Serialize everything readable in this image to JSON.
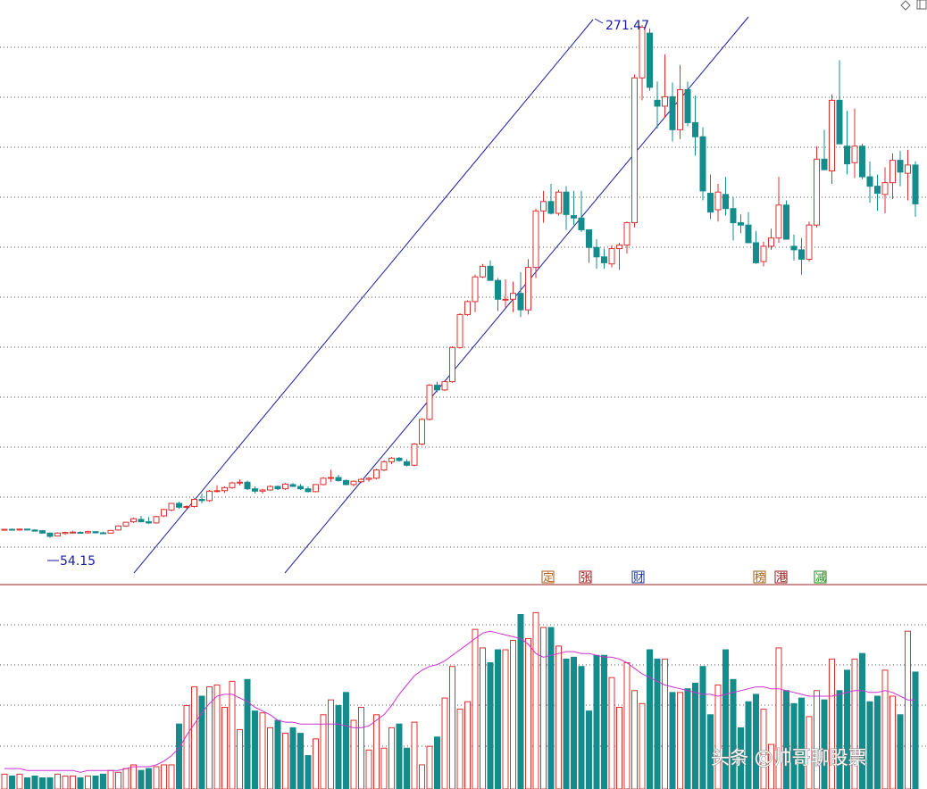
{
  "chart_data": [
    {
      "type": "candlestick",
      "panel": "price",
      "ylim": [
        40,
        275
      ],
      "grid": true,
      "colors": {
        "up": "#e03030",
        "down": "#148c8c",
        "channel": "#1a1aa6",
        "grid": "#555555"
      },
      "annotations": {
        "high": "271.47",
        "low": "54.15"
      },
      "x_count": 121,
      "candles": [
        [
          57.4,
          58.0,
          57.2,
          57.8
        ],
        [
          57.8,
          58.2,
          57.5,
          57.6
        ],
        [
          57.5,
          58.0,
          57.2,
          57.9
        ],
        [
          57.9,
          58.0,
          57.3,
          57.5
        ],
        [
          57.5,
          57.8,
          56.8,
          57.0
        ],
        [
          57.2,
          57.5,
          56.0,
          56.2
        ],
        [
          56.2,
          56.5,
          54.2,
          54.8
        ],
        [
          55.0,
          56.5,
          54.8,
          56.2
        ],
        [
          56.0,
          56.8,
          55.5,
          56.5
        ],
        [
          56.5,
          57.2,
          56.0,
          56.6
        ],
        [
          56.5,
          57.0,
          56.0,
          56.3
        ],
        [
          56.3,
          57.2,
          56.0,
          56.8
        ],
        [
          56.8,
          57.0,
          56.0,
          56.3
        ],
        [
          56.3,
          56.8,
          55.8,
          56.1
        ],
        [
          56.2,
          57.5,
          56.0,
          57.3
        ],
        [
          57.5,
          59.5,
          57.2,
          59.2
        ],
        [
          59.2,
          61.0,
          58.8,
          60.8
        ],
        [
          61.0,
          62.8,
          60.5,
          62.3
        ],
        [
          62.0,
          63.5,
          60.8,
          61.0
        ],
        [
          61.0,
          63.0,
          60.0,
          60.5
        ],
        [
          60.5,
          63.5,
          60.2,
          63.2
        ],
        [
          63.5,
          66.5,
          63.0,
          66.2
        ],
        [
          66.0,
          69.0,
          65.5,
          68.8
        ],
        [
          68.8,
          69.5,
          66.5,
          67.2
        ],
        [
          67.3,
          68.0,
          66.5,
          67.5
        ],
        [
          67.5,
          71.0,
          67.0,
          70.5
        ],
        [
          70.5,
          73.0,
          68.8,
          70.0
        ],
        [
          70.0,
          74.5,
          69.5,
          74.0
        ],
        [
          74.0,
          76.5,
          73.5,
          74.2
        ],
        [
          74.2,
          76.0,
          73.2,
          75.5
        ],
        [
          75.5,
          78.0,
          75.0,
          77.5
        ],
        [
          77.5,
          79.0,
          76.5,
          77.8
        ],
        [
          77.8,
          78.5,
          74.5,
          75.0
        ],
        [
          75.0,
          76.0,
          73.0,
          74.0
        ],
        [
          74.0,
          75.0,
          73.0,
          74.5
        ],
        [
          74.5,
          76.5,
          74.2,
          76.0
        ],
        [
          76.0,
          76.5,
          74.5,
          75.0
        ],
        [
          75.0,
          77.5,
          74.5,
          77.0
        ],
        [
          76.8,
          77.5,
          75.8,
          76.0
        ],
        [
          76.0,
          77.0,
          74.5,
          75.0
        ],
        [
          75.0,
          76.0,
          73.5,
          73.8
        ],
        [
          73.8,
          77.0,
          73.5,
          76.8
        ],
        [
          76.8,
          80.0,
          76.5,
          79.5
        ],
        [
          79.5,
          83.0,
          78.0,
          79.8
        ],
        [
          79.8,
          81.0,
          78.0,
          78.5
        ],
        [
          78.5,
          79.0,
          76.5,
          76.8
        ],
        [
          76.8,
          78.5,
          76.0,
          78.2
        ],
        [
          78.0,
          79.5,
          77.5,
          79.0
        ],
        [
          79.0,
          80.0,
          78.0,
          79.5
        ],
        [
          79.5,
          83.5,
          79.0,
          83.0
        ],
        [
          83.0,
          87.0,
          82.5,
          86.5
        ],
        [
          86.5,
          88.5,
          85.5,
          88.0
        ],
        [
          88.0,
          88.5,
          86.5,
          87.0
        ],
        [
          86.5,
          87.5,
          84.5,
          85.0
        ],
        [
          85.0,
          94.5,
          84.5,
          94.0
        ],
        [
          94.0,
          105.0,
          93.5,
          104.5
        ],
        [
          104.5,
          119.5,
          104.0,
          119.0
        ],
        [
          119.0,
          120.5,
          116.0,
          117.0
        ],
        [
          117.0,
          121.0,
          116.5,
          120.5
        ],
        [
          120.5,
          135.5,
          120.0,
          135.0
        ],
        [
          135.0,
          149.5,
          134.5,
          149.0
        ],
        [
          149.0,
          155.0,
          148.5,
          154.5
        ],
        [
          154.5,
          166.0,
          150.0,
          165.0
        ],
        [
          165.0,
          170.5,
          164.5,
          169.5
        ],
        [
          169.5,
          172.0,
          168.5,
          163.5
        ],
        [
          163.5,
          164.5,
          150.5,
          155.5
        ],
        [
          155.5,
          164.0,
          152.0,
          155.5
        ],
        [
          155.5,
          163.0,
          150.0,
          158.0
        ],
        [
          158.0,
          167.0,
          148.0,
          151.0
        ],
        [
          151.0,
          172.5,
          149.0,
          169.0
        ],
        [
          169.0,
          194.0,
          164.5,
          193.0
        ],
        [
          193.0,
          201.5,
          188.0,
          197.0
        ],
        [
          197.0,
          204.5,
          191.5,
          192.0
        ],
        [
          192.0,
          202.0,
          191.0,
          201.0
        ],
        [
          201.0,
          203.5,
          185.0,
          191.5
        ],
        [
          191.0,
          201.5,
          187.0,
          190.0
        ],
        [
          190.0,
          201.5,
          184.0,
          185.0
        ],
        [
          185.0,
          182.0,
          171.0,
          177.5
        ],
        [
          177.5,
          181.0,
          168.5,
          173.5
        ],
        [
          173.5,
          177.0,
          168.5,
          171.0
        ],
        [
          170.5,
          178.5,
          169.0,
          177.0
        ],
        [
          177.0,
          179.5,
          168.0,
          178.5
        ],
        [
          178.5,
          188.5,
          175.0,
          188.0
        ],
        [
          188.0,
          251.0,
          186.0,
          249.5
        ],
        [
          249.5,
          272.0,
          240.0,
          271.0
        ],
        [
          268.5,
          270.5,
          244.0,
          245.5
        ],
        [
          240.0,
          248.0,
          228.0,
          237.5
        ],
        [
          237.5,
          259.5,
          232.5,
          241.5
        ],
        [
          241.5,
          247.5,
          222.5,
          227.5
        ],
        [
          227.5,
          255.0,
          223.5,
          244.5
        ],
        [
          244.5,
          248.0,
          229.0,
          230.5
        ],
        [
          230.5,
          242.0,
          216.5,
          224.5
        ],
        [
          224.5,
          228.5,
          197.5,
          201.5
        ],
        [
          200.5,
          208.5,
          189.5,
          192.5
        ],
        [
          193.5,
          204.5,
          188.5,
          201.0
        ],
        [
          200.0,
          207.5,
          191.0,
          194.0
        ],
        [
          194.0,
          199.0,
          180.5,
          188.0
        ],
        [
          188.0,
          191.5,
          183.5,
          187.0
        ],
        [
          187.0,
          192.5,
          179.5,
          179.5
        ],
        [
          179.5,
          184.5,
          170.5,
          171.0
        ],
        [
          171.5,
          180.0,
          169.5,
          178.0
        ],
        [
          178.0,
          185.5,
          176.5,
          181.5
        ],
        [
          181.5,
          207.5,
          179.5,
          195.5
        ],
        [
          195.5,
          197.5,
          181.5,
          181.0
        ],
        [
          178.0,
          183.0,
          172.0,
          176.5
        ],
        [
          176.5,
          181.5,
          166.0,
          172.5
        ],
        [
          172.5,
          188.5,
          171.5,
          187.0
        ],
        [
          187.0,
          220.5,
          186.0,
          215.0
        ],
        [
          215.0,
          227.5,
          211.5,
          210.5
        ],
        [
          210.0,
          242.5,
          204.5,
          240.0
        ],
        [
          240.0,
          257.0,
          231.5,
          221.5
        ],
        [
          220.5,
          235.5,
          208.5,
          213.0
        ],
        [
          213.5,
          236.5,
          207.0,
          220.5
        ],
        [
          220.5,
          221.5,
          206.5,
          207.5
        ],
        [
          207.5,
          214.0,
          196.5,
          203.5
        ],
        [
          203.5,
          208.5,
          193.0,
          200.5
        ],
        [
          200.0,
          211.5,
          192.0,
          205.0
        ],
        [
          205.0,
          217.5,
          198.0,
          214.5
        ],
        [
          214.5,
          218.5,
          203.5,
          209.5
        ],
        [
          209.0,
          219.0,
          197.5,
          212.5
        ],
        [
          212.5,
          214.0,
          190.5,
          196.0
        ]
      ]
    },
    {
      "type": "bar",
      "panel": "volume",
      "ylim": [
        0,
        1
      ],
      "volume": [
        0.08,
        0.07,
        0.08,
        0.06,
        0.07,
        0.06,
        0.06,
        0.08,
        0.07,
        0.07,
        0.06,
        0.07,
        0.07,
        0.08,
        0.1,
        0.09,
        0.11,
        0.13,
        0.1,
        0.11,
        0.12,
        0.13,
        0.13,
        0.35,
        0.45,
        0.55,
        0.5,
        0.55,
        0.56,
        0.44,
        0.58,
        0.32,
        0.59,
        0.42,
        0.41,
        0.33,
        0.37,
        0.3,
        0.33,
        0.3,
        0.18,
        0.27,
        0.4,
        0.48,
        0.45,
        0.52,
        0.37,
        0.44,
        0.21,
        0.4,
        0.22,
        0.33,
        0.35,
        0.22,
        0.36,
        0.13,
        0.23,
        0.28,
        0.49,
        0.66,
        0.43,
        0.47,
        0.86,
        0.76,
        0.68,
        0.75,
        0.75,
        0.8,
        0.94,
        0.81,
        0.95,
        0.87,
        0.87,
        0.77,
        0.7,
        0.71,
        0.66,
        0.42,
        0.72,
        0.72,
        0.6,
        0.44,
        0.68,
        0.53,
        0.46,
        0.75,
        0.7,
        0.7,
        0.52,
        0.52,
        0.54,
        0.57,
        0.66,
        0.4,
        0.56,
        0.75,
        0.59,
        0.33,
        0.47,
        0.51,
        0.43,
        0.24,
        0.76,
        0.53,
        0.46,
        0.49,
        0.39,
        0.53,
        0.48,
        0.7,
        0.53,
        0.64,
        0.7,
        0.73,
        0.47,
        0.5,
        0.64,
        0.5,
        0.4,
        0.85,
        0.63
      ],
      "ma_line": [
        0.11,
        0.11,
        0.11,
        0.1,
        0.1,
        0.1,
        0.1,
        0.1,
        0.1,
        0.1,
        0.09,
        0.1,
        0.1,
        0.1,
        0.1,
        0.1,
        0.11,
        0.12,
        0.12,
        0.12,
        0.13,
        0.15,
        0.18,
        0.22,
        0.29,
        0.35,
        0.41,
        0.46,
        0.5,
        0.51,
        0.51,
        0.49,
        0.47,
        0.44,
        0.42,
        0.4,
        0.37,
        0.36,
        0.36,
        0.35,
        0.35,
        0.35,
        0.35,
        0.35,
        0.35,
        0.34,
        0.33,
        0.33,
        0.34,
        0.37,
        0.4,
        0.45,
        0.51,
        0.56,
        0.61,
        0.64,
        0.66,
        0.67,
        0.69,
        0.72,
        0.75,
        0.78,
        0.81,
        0.84,
        0.85,
        0.84,
        0.83,
        0.82,
        0.81,
        0.78,
        0.73,
        0.71,
        0.72,
        0.73,
        0.74,
        0.74,
        0.73,
        0.73,
        0.72,
        0.71,
        0.71,
        0.7,
        0.68,
        0.65,
        0.62,
        0.6,
        0.58,
        0.56,
        0.55,
        0.54,
        0.53,
        0.52,
        0.51,
        0.51,
        0.5,
        0.51,
        0.52,
        0.53,
        0.54,
        0.55,
        0.55,
        0.54,
        0.54,
        0.53,
        0.52,
        0.51,
        0.5,
        0.5,
        0.5,
        0.5,
        0.51,
        0.52,
        0.53,
        0.53,
        0.52,
        0.52,
        0.53,
        0.52,
        0.5,
        0.48,
        0.48
      ],
      "colors": {
        "up": "#e03030",
        "down": "#148c8c",
        "ma": "#d030d0"
      }
    }
  ],
  "badges": [
    {
      "label": "定",
      "color": "#b05a10"
    },
    {
      "label": "张",
      "color": "#a01515"
    },
    {
      "label": "财",
      "color": "#203a90"
    },
    {
      "label": "榜",
      "color": "#a06010"
    },
    {
      "label": "港",
      "color": "#901818"
    },
    {
      "label": "减",
      "color": "#1a8a1a"
    }
  ],
  "corner_icons": [
    "diamond-icon",
    "window-icon"
  ],
  "watermark": "头条 @帅哥聊股票"
}
